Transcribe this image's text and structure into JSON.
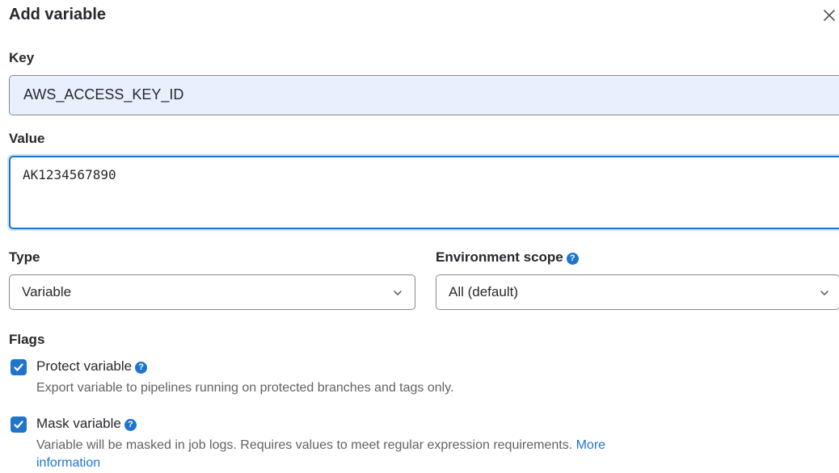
{
  "dialog": {
    "title": "Add variable"
  },
  "key": {
    "label": "Key",
    "value": "AWS_ACCESS_KEY_ID"
  },
  "value": {
    "label": "Value",
    "value": "AK1234567890"
  },
  "type": {
    "label": "Type",
    "selected": "Variable"
  },
  "environment_scope": {
    "label": "Environment scope",
    "selected": "All (default)"
  },
  "flags": {
    "label": "Flags",
    "protect": {
      "label": "Protect variable",
      "checked": true,
      "help": "Export variable to pipelines running on protected branches and tags only."
    },
    "mask": {
      "label": "Mask variable",
      "checked": true,
      "help": "Variable will be masked in job logs. Requires values to meet regular expression requirements.",
      "link_text_1": "More",
      "link_text_2": "information"
    }
  },
  "colors": {
    "accent": "#1f75cb",
    "autofill": "#e8f0fe",
    "muted_text": "#626168"
  },
  "icons": [
    "close-icon",
    "chevron-down-icon",
    "help-icon",
    "checkmark-icon"
  ]
}
